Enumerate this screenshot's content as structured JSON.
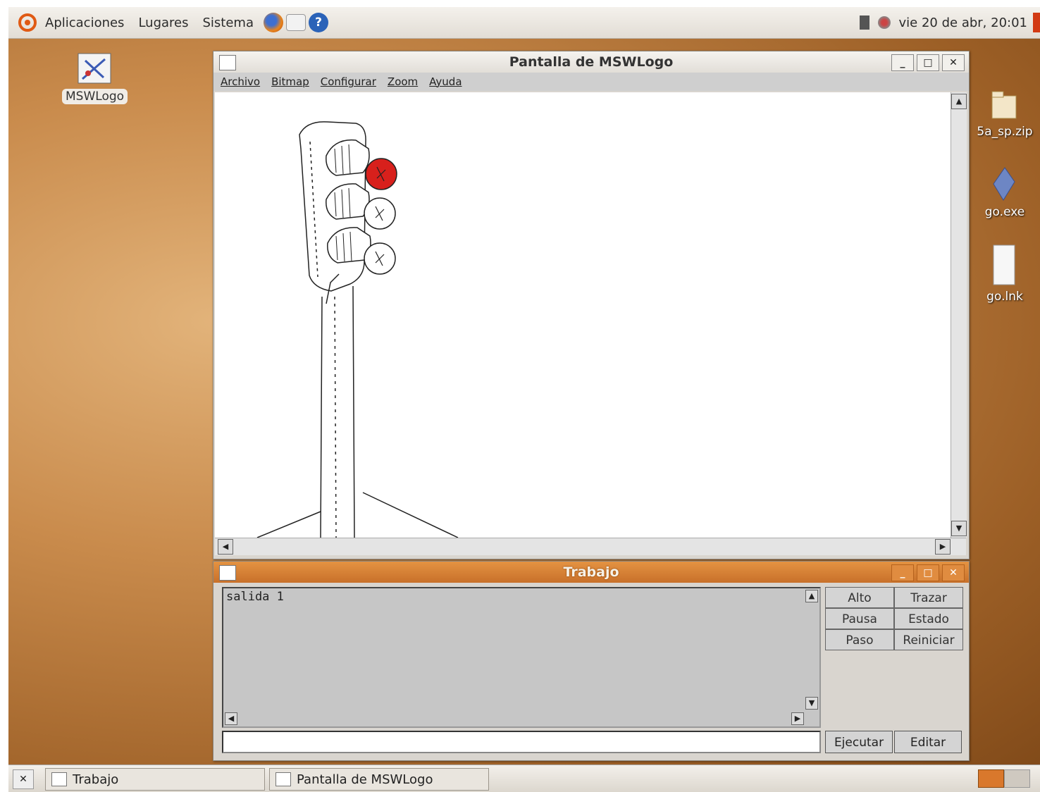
{
  "top_panel": {
    "menus": [
      "Aplicaciones",
      "Lugares",
      "Sistema"
    ],
    "clock": "vie 20 de abr, 20:01"
  },
  "desktop": {
    "icons": [
      {
        "label": "MSWLogo"
      },
      {
        "label": "5a_sp.zip"
      },
      {
        "label": "go.exe"
      },
      {
        "label": "go.lnk"
      }
    ]
  },
  "main_window": {
    "title": "Pantalla de MSWLogo",
    "menus": [
      "Archivo",
      "Bitmap",
      "Configurar",
      "Zoom",
      "Ayuda"
    ]
  },
  "trabajo": {
    "title": "Trabajo",
    "output": "salida 1",
    "command_value": "",
    "buttons": [
      "Alto",
      "Trazar",
      "Pausa",
      "Estado",
      "Paso",
      "Reiniciar"
    ],
    "execute_label": "Ejecutar",
    "edit_label": "Editar"
  },
  "taskbar": {
    "tasks": [
      "Trabajo",
      "Pantalla de MSWLogo"
    ]
  },
  "colors": {
    "red_light": "#d8201c",
    "accent_orange": "#e08c40"
  }
}
